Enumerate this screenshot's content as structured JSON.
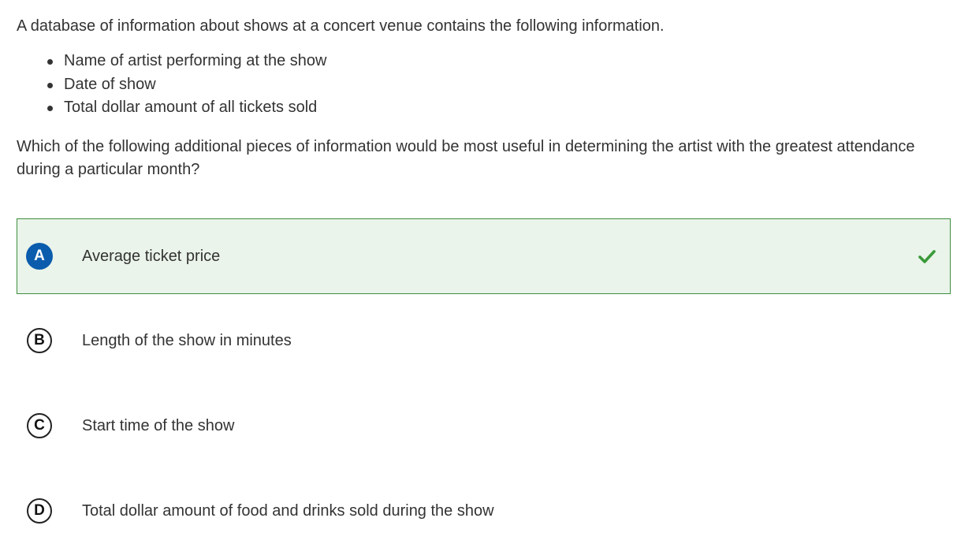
{
  "question": {
    "intro": "A database of information about shows at a concert venue contains the following information.",
    "bullets": [
      "Name of artist performing at the show",
      "Date of show",
      "Total dollar amount of all tickets sold"
    ],
    "prompt": "Which of the following additional pieces of information would be most useful in determining the artist with the greatest attendance during a particular month?"
  },
  "choices": [
    {
      "letter": "A",
      "text": "Average ticket price",
      "selected": true,
      "correct": true
    },
    {
      "letter": "B",
      "text": "Length of the show in minutes",
      "selected": false,
      "correct": false
    },
    {
      "letter": "C",
      "text": "Start time of the show",
      "selected": false,
      "correct": false
    },
    {
      "letter": "D",
      "text": "Total dollar amount of food and drinks sold during the show",
      "selected": false,
      "correct": false
    }
  ],
  "colors": {
    "correct_background": "#eaf4ea",
    "correct_border": "#3e8e3e",
    "selected_letter": "#0b5cad",
    "checkmark": "#3a9a3a",
    "text": "#333333"
  },
  "icons": {
    "correct_marker": "checkmark-icon"
  }
}
